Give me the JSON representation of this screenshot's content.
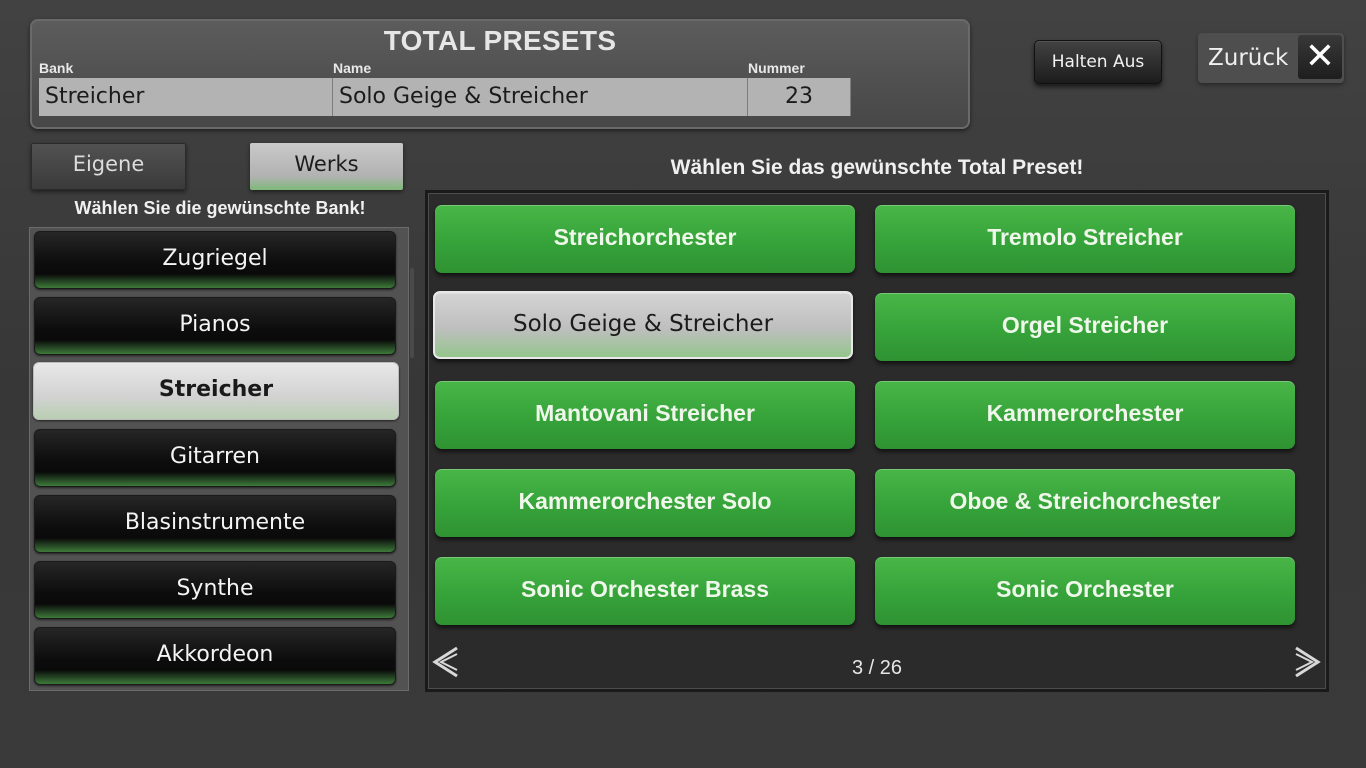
{
  "header": {
    "title": "TOTAL PRESETS",
    "bank_label": "Bank",
    "name_label": "Name",
    "number_label": "Nummer",
    "bank_value": "Streicher",
    "name_value": "Solo Geige & Streicher",
    "number_value": "23"
  },
  "top_buttons": {
    "hold": "Halten Aus",
    "back": "Zurück",
    "close_icon": "close-icon"
  },
  "source_toggle": {
    "own": "Eigene",
    "factory": "Werks",
    "selected": "Werks"
  },
  "bank_prompt": "Wählen Sie die gewünschte Bank!",
  "preset_prompt": "Wählen Sie das gewünschte Total Preset!",
  "banks": [
    {
      "label": "Zugriegel"
    },
    {
      "label": "Pianos"
    },
    {
      "label": "Streicher",
      "selected": true
    },
    {
      "label": "Gitarren"
    },
    {
      "label": "Blasinstrumente"
    },
    {
      "label": "Synthe"
    },
    {
      "label": "Akkordeon"
    }
  ],
  "presets": [
    {
      "label": "Streichorchester"
    },
    {
      "label": "Tremolo Streicher"
    },
    {
      "label": "Solo Geige & Streicher",
      "selected": true
    },
    {
      "label": "Orgel Streicher"
    },
    {
      "label": "Mantovani Streicher"
    },
    {
      "label": "Kammerorchester"
    },
    {
      "label": "Kammerorchester Solo"
    },
    {
      "label": "Oboe & Streichorchester"
    },
    {
      "label": "Sonic Orchester Brass"
    },
    {
      "label": "Sonic Orchester"
    }
  ],
  "pagination": {
    "text": "3 / 26",
    "prev_icon": "chevron-left-icon",
    "next_icon": "chevron-right-icon"
  },
  "colors": {
    "accent_green": "#3aa63c",
    "selected_gray": "#c6c6c6",
    "background": "#3b3b3b"
  }
}
